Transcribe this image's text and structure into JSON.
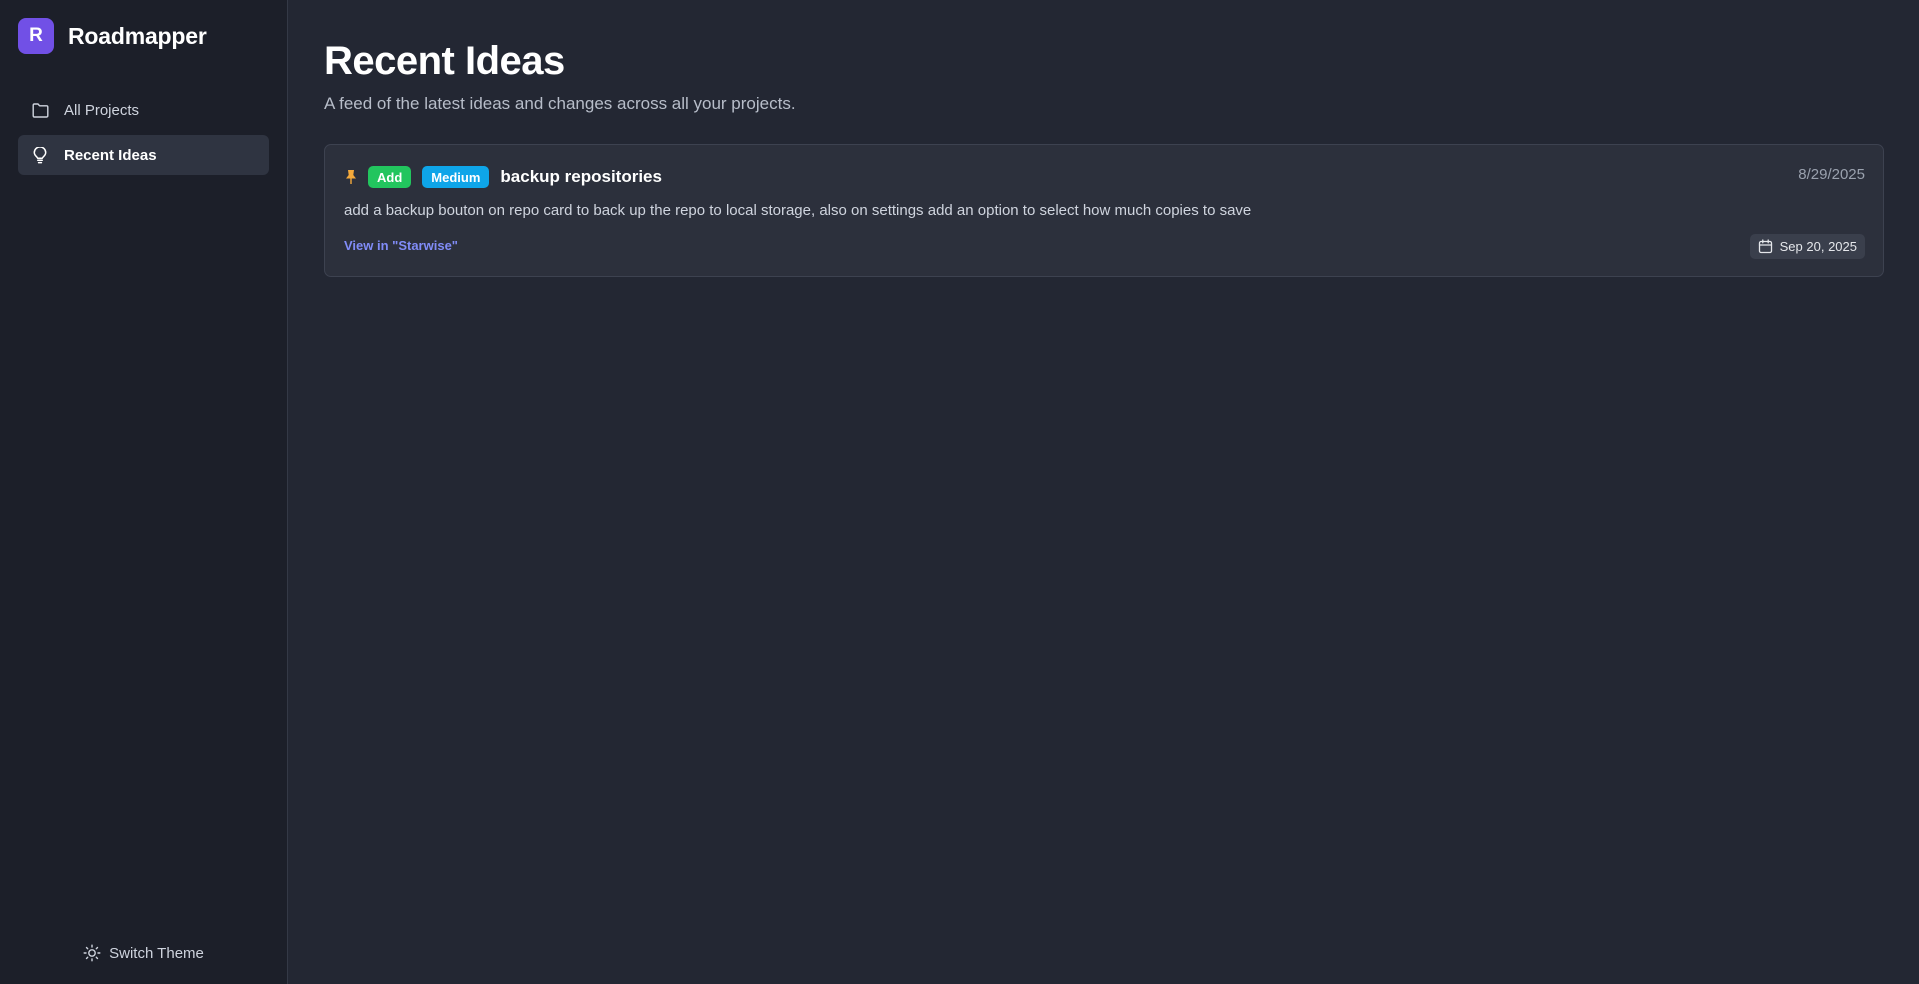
{
  "app": {
    "logo_letter": "R",
    "name": "Roadmapper"
  },
  "sidebar": {
    "items": [
      {
        "label": "All Projects",
        "icon": "folder-icon",
        "active": false
      },
      {
        "label": "Recent Ideas",
        "icon": "lightbulb-icon",
        "active": true
      }
    ],
    "theme_switch_label": "Switch Theme",
    "theme_icon": "sun-icon"
  },
  "main": {
    "title": "Recent Ideas",
    "subtitle": "A feed of the latest ideas and changes across all your projects.",
    "ideas": [
      {
        "pinned": true,
        "type_badge": "Add",
        "priority_badge": "Medium",
        "title": "backup repositories",
        "date": "8/29/2025",
        "description": "add a backup bouton on repo card to back up the repo to local storage, also on settings add an option to select how much copies to save",
        "link_label": "View in \"Starwise\"",
        "due_date": "Sep 20, 2025"
      }
    ]
  },
  "colors": {
    "accent": "#7150e6",
    "badge_add": "#22c55e",
    "badge_medium": "#0ea5e9",
    "link": "#818cf8",
    "pin": "#f4a93b"
  }
}
